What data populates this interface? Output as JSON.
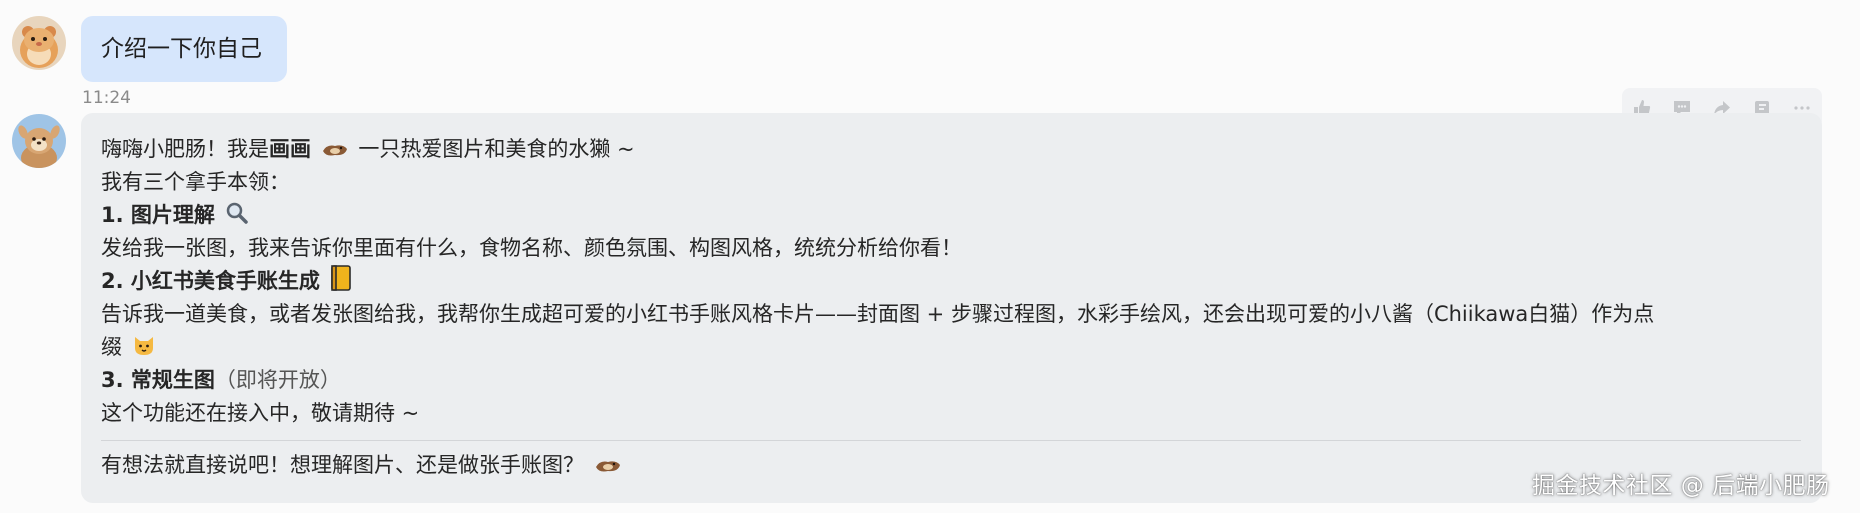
{
  "user_message": {
    "text": "介绍一下你自己",
    "time": "11:24"
  },
  "bot_message": {
    "intro_pre": "嗨嗨小肥肠！我是",
    "intro_name": "画画",
    "intro_post": "一只热爱图片和美食的水獭 ~",
    "skills_heading": "我有三个拿手本领：",
    "skill_1_title": "1. 图片理解",
    "skill_1_desc": "发给我一张图，我来告诉你里面有什么，食物名称、颜色氛围、构图风格，统统分析给你看！",
    "skill_2_title": "2. 小红书美食手账生成",
    "skill_2_desc": "告诉我一道美食，或者发张图给我，我帮你生成超可爱的小红书手账风格卡片——封面图 + 步骤过程图，水彩手绘风，还会出现可爱的小八酱（Chiikawa白猫）作为点",
    "skill_2_desc_cont": "缀",
    "skill_3_title": "3. 常规生图",
    "skill_3_note": "（即将开放）",
    "skill_3_desc": "这个功能还在接入中，敬请期待 ~",
    "closing": "有想法就直接说吧！想理解图片、还是做张手账图？"
  },
  "toolbar": {
    "icons": [
      "thumbs-up-icon",
      "comment-icon",
      "share-icon",
      "save-icon",
      "more-icon"
    ]
  },
  "watermark": "掘金技术社区 @ 后端小肥肠",
  "colors": {
    "user_bubble": "#d6e6fc",
    "bot_bubble": "#eceef0",
    "background": "#fbfbfb"
  }
}
